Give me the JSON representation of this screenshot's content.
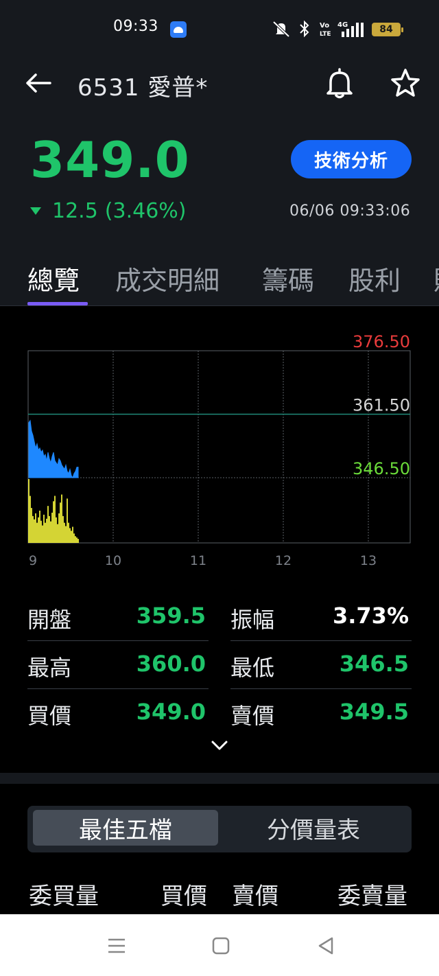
{
  "status_bar": {
    "time": "09:33",
    "battery": "84",
    "icons": [
      "android-notification-icon",
      "mute-icon",
      "bluetooth-icon",
      "volte-icon",
      "4g-signal-icon",
      "battery-icon"
    ]
  },
  "header": {
    "title": "6531 愛普*",
    "price": "349.0",
    "change": "12.5",
    "change_pct": "(3.46%)",
    "technical_button": "技術分析",
    "timestamp": "06/06 09:33:06",
    "price_color": "#1fc46a"
  },
  "tabs": [
    {
      "label": "總覽"
    },
    {
      "label": "成交明細"
    },
    {
      "label": "籌碼"
    },
    {
      "label": "股利"
    },
    {
      "label": "財"
    }
  ],
  "chart_data": {
    "type": "line",
    "y_labels": [
      "376.50",
      "361.50",
      "346.50"
    ],
    "ylim": [
      346.5,
      376.5
    ],
    "reference_price": 361.5,
    "x_ticks": [
      "9",
      "10",
      "11",
      "12",
      "13"
    ],
    "price_series": {
      "name": "",
      "color": "#1e88ff",
      "x": [
        0,
        1,
        2,
        3,
        4,
        5,
        6,
        7,
        8,
        9,
        10,
        11,
        12,
        13,
        14,
        15,
        16,
        17,
        18,
        19,
        20,
        21,
        22,
        23,
        24,
        25,
        26,
        27,
        28,
        29,
        30,
        31,
        32,
        33,
        34,
        35,
        36
      ],
      "values": [
        359.5,
        360.0,
        357.5,
        356.5,
        355.0,
        353.5,
        354.5,
        353.0,
        353.5,
        352.5,
        353.0,
        351.5,
        352.0,
        350.5,
        352.5,
        351.0,
        350.0,
        351.5,
        352.5,
        350.5,
        350.0,
        349.5,
        351.0,
        350.5,
        349.5,
        349.0,
        348.5,
        349.5,
        348.0,
        347.5,
        348.5,
        347.0,
        346.5,
        347.5,
        348.0,
        349.0,
        349.0
      ]
    },
    "volume_series": {
      "name": "",
      "color": "#ecec3a",
      "values": [
        95,
        70,
        52,
        40,
        35,
        44,
        30,
        38,
        48,
        33,
        26,
        42,
        30,
        36,
        55,
        40,
        32,
        45,
        62,
        70,
        38,
        28,
        44,
        60,
        72,
        40,
        30,
        25,
        66,
        30,
        22,
        18,
        24,
        14,
        10,
        8,
        6
      ]
    },
    "colors": {
      "high": "#e83b3b",
      "ref": "#d4d4d4",
      "low": "#6bdb3a",
      "grid": "#5a5f66",
      "ref_line": "#1f8a78"
    }
  },
  "stats": [
    {
      "label": "開盤",
      "value": "359.5"
    },
    {
      "label": "振幅",
      "value": "3.73%"
    },
    {
      "label": "最高",
      "value": "360.0"
    },
    {
      "label": "最低",
      "value": "346.5"
    },
    {
      "label": "買價",
      "value": "349.0"
    },
    {
      "label": "賣價",
      "value": "349.5"
    }
  ],
  "order_book": {
    "segments": [
      "最佳五檔",
      "分價量表"
    ],
    "columns": [
      "委買量",
      "買價",
      "賣價",
      "委賣量"
    ]
  }
}
